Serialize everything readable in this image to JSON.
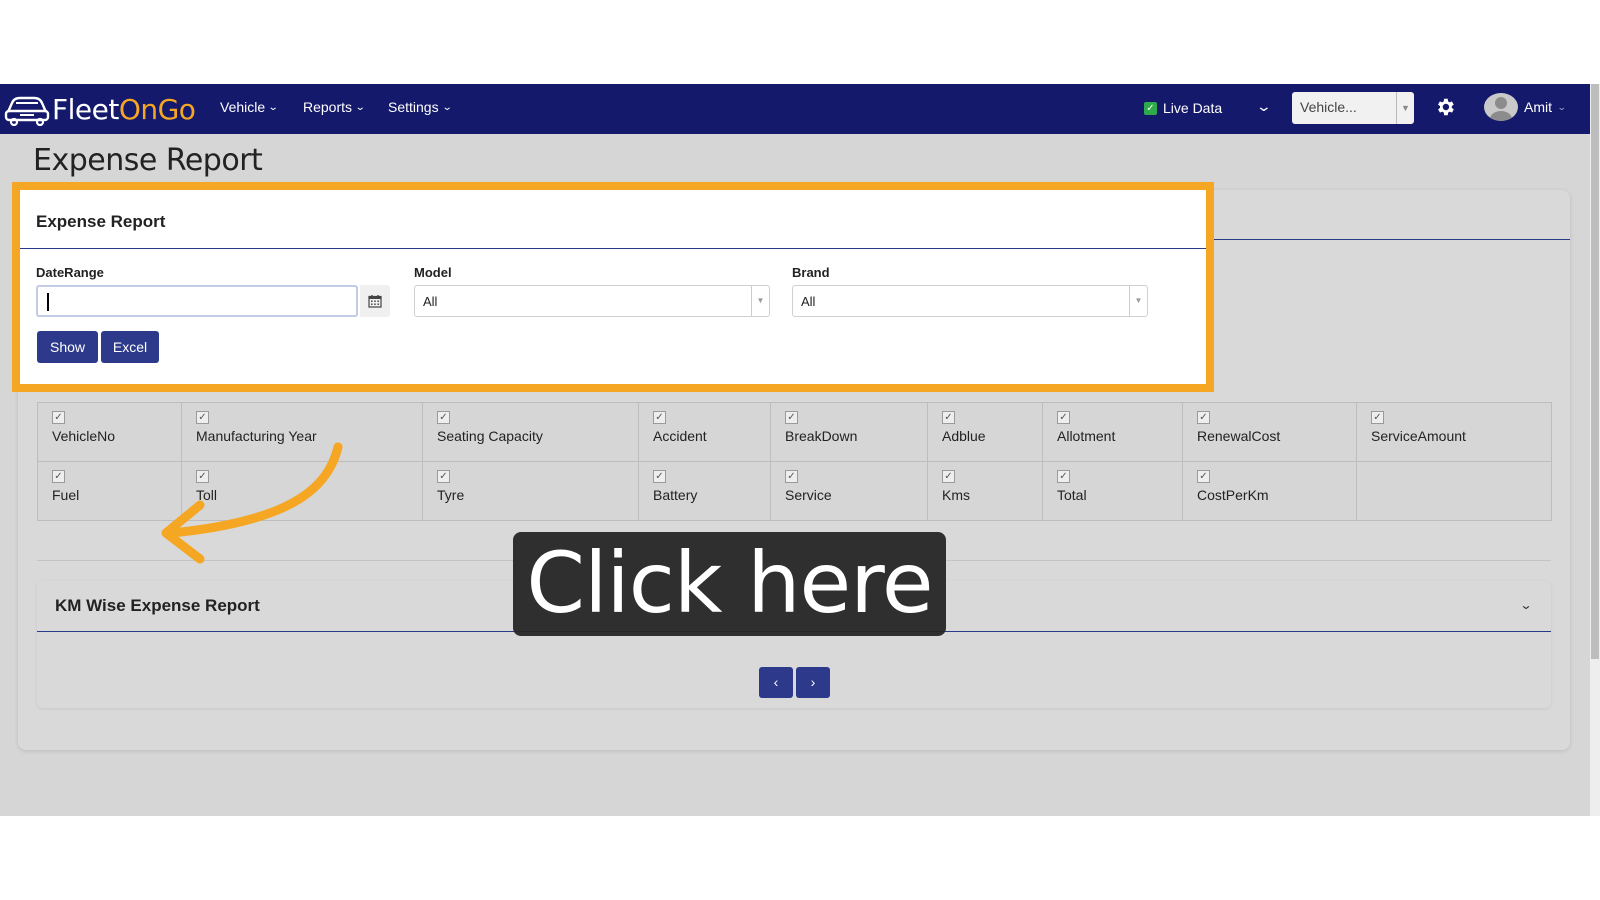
{
  "navbar": {
    "logo_part1": "Fleet",
    "logo_part2": "OnGo",
    "menus": [
      "Vehicle",
      "Reports",
      "Settings"
    ],
    "live_data_label": "Live Data",
    "live_data_checked": true,
    "vehicle_select_value": "Vehicle...",
    "user_name": "Amit",
    "bg_color": "#14196b",
    "accent_color": "#f5a623"
  },
  "page": {
    "title": "Expense Report"
  },
  "filter": {
    "title": "Expense Report",
    "date_label": "DateRange",
    "date_value": "",
    "model_label": "Model",
    "model_value": "All",
    "brand_label": "Brand",
    "brand_value": "All",
    "show_button": "Show",
    "excel_button": "Excel"
  },
  "columns": {
    "row1": [
      "VehicleNo",
      "Manufacturing Year",
      "Seating Capacity",
      "Accident",
      "BreakDown",
      "Adblue",
      "Allotment",
      "RenewalCost",
      "ServiceAmount"
    ],
    "row2": [
      "Fuel",
      "Toll",
      "Tyre",
      "Battery",
      "Service",
      "Kms",
      "Total",
      "CostPerKm",
      ""
    ]
  },
  "km_section": {
    "title": "KM Wise Expense Report",
    "prev_label": "‹",
    "next_label": "›"
  },
  "overlay": {
    "text": "Click here"
  }
}
